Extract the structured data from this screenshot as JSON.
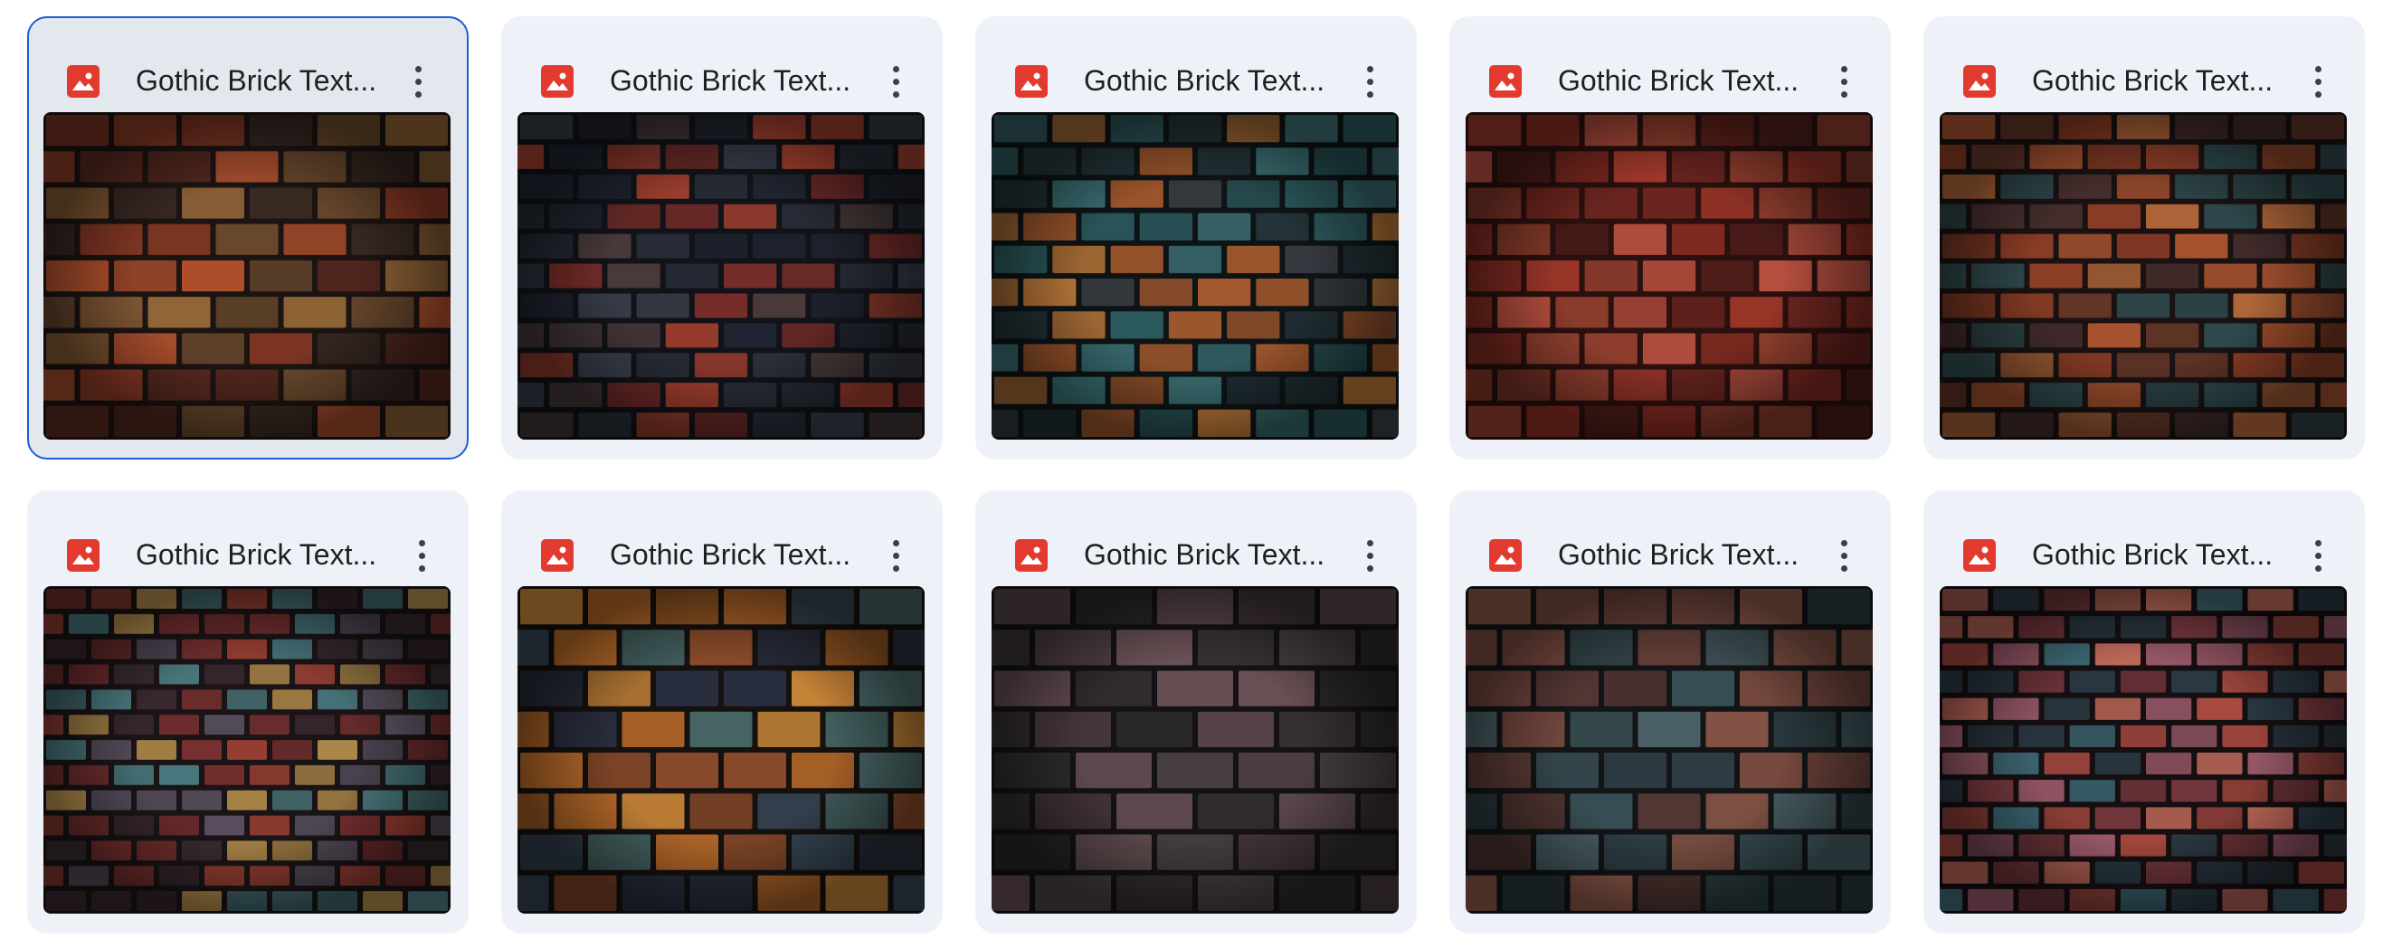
{
  "files": [
    {
      "title": "Gothic Brick Text...",
      "icon": "image-file-icon",
      "selected": true,
      "palette": [
        "#5a2a20",
        "#8c3a26",
        "#b2512e",
        "#6b4a2e",
        "#3a2a24",
        "#9a6a3a"
      ],
      "mortar": "#1c1412",
      "rows": 9,
      "cols": 6
    },
    {
      "title": "Gothic Brick Text...",
      "icon": "image-file-icon",
      "selected": false,
      "palette": [
        "#2a2f3a",
        "#3a3f4c",
        "#7a2e2a",
        "#a4402f",
        "#4a3a3a",
        "#1f2430"
      ],
      "mortar": "#111318",
      "rows": 11,
      "cols": 7
    },
    {
      "title": "Gothic Brick Text...",
      "icon": "image-file-icon",
      "selected": false,
      "palette": [
        "#2d5a5e",
        "#3b6f73",
        "#a65a2e",
        "#c07a3a",
        "#3a3f44",
        "#24353a"
      ],
      "mortar": "#0e1416",
      "rows": 10,
      "cols": 7
    },
    {
      "title": "Gothic Brick Text...",
      "icon": "image-file-icon",
      "selected": false,
      "palette": [
        "#8a2e24",
        "#a63a2c",
        "#6e2620",
        "#b85040",
        "#4e1e1a",
        "#93402f"
      ],
      "mortar": "#2a100e",
      "rows": 9,
      "cols": 7
    },
    {
      "title": "Gothic Brick Text...",
      "icon": "image-file-icon",
      "selected": false,
      "palette": [
        "#8c3e26",
        "#a85330",
        "#4a3030",
        "#2f4a4e",
        "#6a3a2a",
        "#b86a3c"
      ],
      "mortar": "#1a1212",
      "rows": 11,
      "cols": 7
    },
    {
      "title": "Gothic Brick Text...",
      "icon": "image-file-icon",
      "selected": false,
      "palette": [
        "#4a7a80",
        "#7a3030",
        "#9a4034",
        "#b08a4a",
        "#3a2a30",
        "#5a5060"
      ],
      "mortar": "#1a1416",
      "rows": 13,
      "cols": 9
    },
    {
      "title": "Gothic Brick Text...",
      "icon": "image-file-icon",
      "selected": false,
      "palette": [
        "#b86a2a",
        "#d08a3a",
        "#3a4a5a",
        "#4a6a6a",
        "#8a4a2a",
        "#2a3040"
      ],
      "mortar": "#14110f",
      "rows": 8,
      "cols": 6
    },
    {
      "title": "Gothic Brick Text...",
      "icon": "image-file-icon",
      "selected": false,
      "palette": [
        "#4a3a3e",
        "#5e4a4e",
        "#3a3336",
        "#6a5256",
        "#2e2a2e",
        "#4e4448"
      ],
      "mortar": "#141214",
      "rows": 8,
      "cols": 5
    },
    {
      "title": "Gothic Brick Text...",
      "icon": "image-file-icon",
      "selected": false,
      "palette": [
        "#7a4a40",
        "#8e5a4a",
        "#3a5056",
        "#4a6066",
        "#5a3a36",
        "#2e3e44"
      ],
      "mortar": "#121416",
      "rows": 8,
      "cols": 6
    },
    {
      "title": "Gothic Brick Text...",
      "icon": "image-file-icon",
      "selected": false,
      "palette": [
        "#a84a40",
        "#c06a5a",
        "#3e6a76",
        "#7a3a40",
        "#9a5a6a",
        "#2a3a44"
      ],
      "mortar": "#160f12",
      "rows": 12,
      "cols": 8
    }
  ]
}
